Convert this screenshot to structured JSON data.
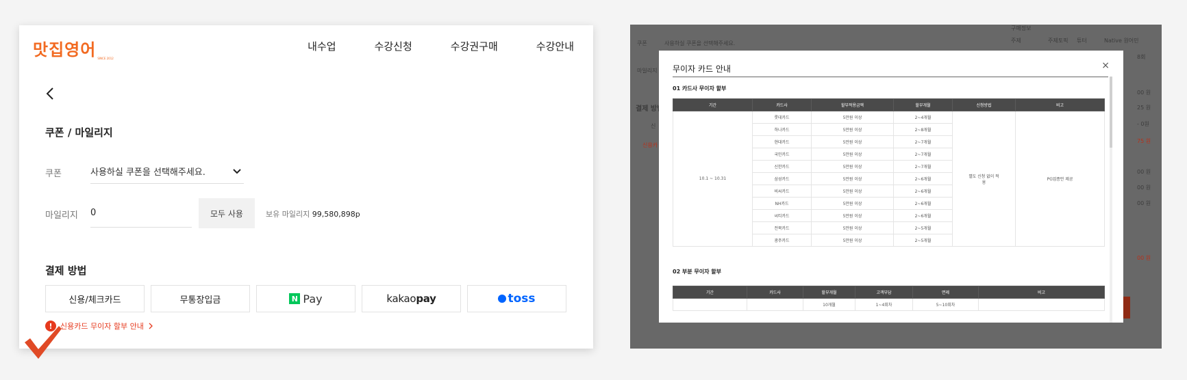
{
  "brand": {
    "logo": "맛집영어",
    "logo_sub": "SINCE 2012"
  },
  "nav": [
    "내수업",
    "수강신청",
    "수강권구매",
    "수강안내"
  ],
  "coupon_section": {
    "title": "쿠폰 / 마일리지",
    "coupon_label": "쿠폰",
    "coupon_placeholder": "사용하실 쿠폰을 선택해주세요.",
    "mileage_label": "마일리지",
    "mileage_value": "0",
    "use_all": "모두 사용",
    "mileage_own_label": "보유 마일리지",
    "mileage_own_value": "99,580,898p"
  },
  "payment": {
    "title": "결제 방법",
    "methods": [
      "신용/체크카드",
      "무통장입금"
    ],
    "npay_letter": "N",
    "npay_text": "Pay",
    "kakao_a": "kakao",
    "kakao_b": "pay",
    "toss": "toss",
    "installment_link": "신용카드 무이자 할부 안내",
    "warn_glyph": "!"
  },
  "background": {
    "coupon": "쿠폰",
    "coupon_select": "사용하실 쿠폰을 선택해주세요.",
    "mileage": "마일리지",
    "payment": "결제 방법",
    "card_short": "신",
    "installment_link": "신용카",
    "purchase_info": "구매정보",
    "topic_label": "주제",
    "topic_value": "주제토픽",
    "teacher_label": "튜터",
    "teacher_value": "Native 원어민",
    "right_values": [
      "8회",
      "00 원",
      "25 원",
      "- 0원",
      "75 원",
      "00 원",
      "00 원",
      "00 원",
      "00 원"
    ]
  },
  "modal": {
    "title": "무이자 카드 안내",
    "close": "×",
    "section1": "01 카드사 무이자 할부",
    "headers1": [
      "기간",
      "카드사",
      "할부적용금액",
      "할부개월",
      "신청방법",
      "비고"
    ],
    "period": "10.1 ~ 10.31",
    "method": "별도 신청 없이 적용",
    "note": "PG업종만 제공",
    "rows1": [
      {
        "card": "롯데카드",
        "amount": "5만원 이상",
        "months": "2~4개월"
      },
      {
        "card": "하나카드",
        "amount": "5만원 이상",
        "months": "2~8개월"
      },
      {
        "card": "현대카드",
        "amount": "5만원 이상",
        "months": "2~7개월"
      },
      {
        "card": "국민카드",
        "amount": "5만원 이상",
        "months": "2~7개월"
      },
      {
        "card": "신한카드",
        "amount": "5만원 이상",
        "months": "2~7개월"
      },
      {
        "card": "삼성카드",
        "amount": "5만원 이상",
        "months": "2~6개월"
      },
      {
        "card": "비씨카드",
        "amount": "5만원 이상",
        "months": "2~6개월"
      },
      {
        "card": "NH카드",
        "amount": "5만원 이상",
        "months": "2~6개월"
      },
      {
        "card": "씨티카드",
        "amount": "5만원 이상",
        "months": "2~6개월"
      },
      {
        "card": "전북카드",
        "amount": "5만원 이상",
        "months": "2~5개월"
      },
      {
        "card": "광주카드",
        "amount": "5만원 이상",
        "months": "2~5개월"
      }
    ],
    "section2": "02 부분 무이자 할부",
    "headers2": [
      "기간",
      "카드사",
      "할부개월",
      "고객부담",
      "면제",
      "비고"
    ],
    "row2": {
      "months": "10개월",
      "customer": "1~4회차",
      "exempt": "5~10회차"
    }
  }
}
